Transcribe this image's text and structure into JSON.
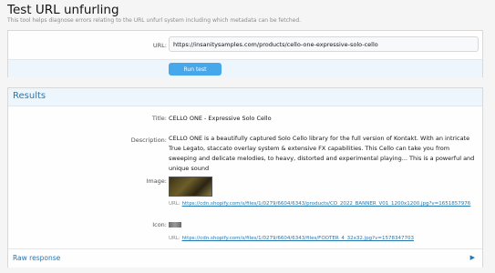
{
  "page": {
    "title": "Test URL unfurling",
    "description": "This tool helps diagnose errors relating to the URL unfurl system including which metadata can be fetched."
  },
  "form": {
    "url_label": "URL:",
    "url_value": "https://insanitysamples.com/products/cello-one-expressive-solo-cello",
    "run_button": "Run test"
  },
  "results": {
    "header": "Results",
    "title_label": "Title:",
    "title_value": "CELLO ONE - Expressive Solo Cello",
    "description_label": "Description:",
    "description_value": "CELLO ONE is a beautifully captured Solo Cello library for the full version of Kontakt. With an intricate True Legato, staccato overlay system & extensive FX capabilities. This Cello can take you from sweeping and delicate melodies, to heavy, distorted and experimental playing... This is a powerful and unique sound",
    "image_label": "Image:",
    "image_url_prefix": "URL:",
    "image_url": "https://cdn.shopify.com/s/files/1/0279/6604/6343/products/CO_2022_BANNER_V01_1200x1200.jpg?v=1651857976",
    "icon_label": "Icon:",
    "icon_url_prefix": "URL:",
    "icon_url": "https://cdn.shopify.com/s/files/1/0279/6604/6343/files/FOOTER_4_32x32.jpg?v=1578347703",
    "raw_response": "Raw response",
    "chevron_icon": "chevron-right-icon"
  }
}
